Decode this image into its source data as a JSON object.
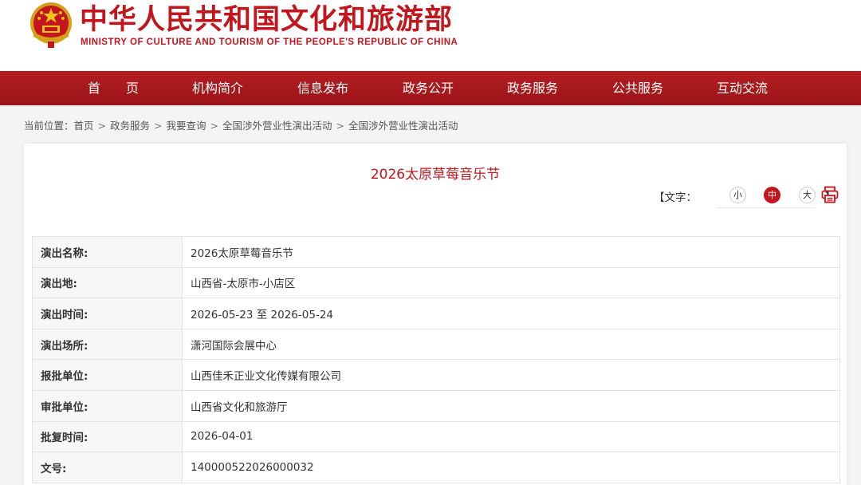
{
  "header": {
    "title": "中华人民共和国文化和旅游部",
    "subtitle": "MINISTRY OF CULTURE AND TOURISM OF THE PEOPLE'S REPUBLIC OF CHINA"
  },
  "nav": {
    "items": [
      "首　　页",
      "机构简介",
      "信息发布",
      "政务公开",
      "政务服务",
      "公共服务",
      "互动交流"
    ]
  },
  "breadcrumb": {
    "prefix": "当前位置：",
    "items": [
      "首页",
      "政务服务",
      "我要查询",
      "全国涉外营业性演出活动",
      "全国涉外营业性演出活动"
    ],
    "separator": ">"
  },
  "event": {
    "title": "2026太原草莓音乐节"
  },
  "font_size": {
    "label": "【文字：",
    "small": "小",
    "medium": "中",
    "large": "大",
    "close": "】",
    "active": "medium"
  },
  "details": [
    {
      "label": "演出名称:",
      "value": "2026太原草莓音乐节"
    },
    {
      "label": "演出地:",
      "value": "山西省-太原市-小店区"
    },
    {
      "label": "演出时间:",
      "value": "2026-05-23 至 2026-05-24"
    },
    {
      "label": "演出场所:",
      "value": "潇河国际会展中心"
    },
    {
      "label": "报批单位:",
      "value": "山西佳禾正业文化传媒有限公司"
    },
    {
      "label": "审批单位:",
      "value": "山西省文化和旅游厅"
    },
    {
      "label": "批复时间:",
      "value": "2026-04-01"
    },
    {
      "label": "文号:",
      "value": "140000522026000032"
    }
  ],
  "colors": {
    "brand_red": "#c3161c",
    "nav_red": "#a8191d"
  },
  "icons": {
    "emblem": "national-emblem-icon",
    "print": "printer-icon"
  }
}
